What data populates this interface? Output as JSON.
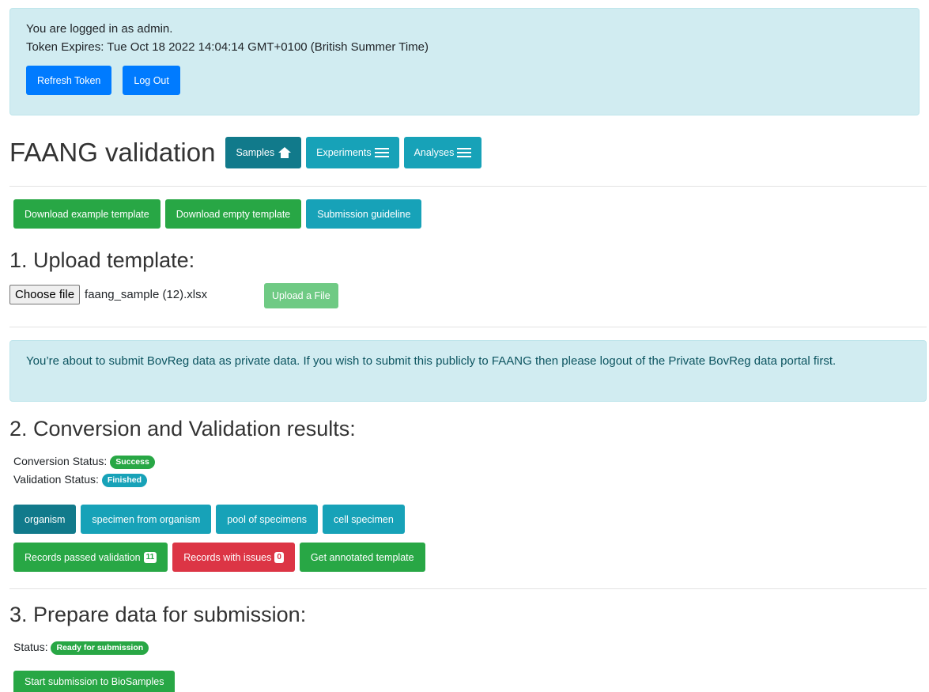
{
  "login": {
    "line1": "You are logged in as admin.",
    "line2": "Token Expires: Tue Oct 18 2022 14:04:14 GMT+0100 (British Summer Time)",
    "refresh_label": "Refresh Token",
    "logout_label": "Log Out"
  },
  "header": {
    "title": "FAANG validation",
    "tabs": [
      {
        "label": "Samples",
        "icon": "home-icon",
        "active": true
      },
      {
        "label": "Experiments",
        "icon": "menu-icon",
        "active": false
      },
      {
        "label": "Analyses",
        "icon": "menu-icon",
        "active": false
      }
    ]
  },
  "templates": {
    "download_example": "Download example template",
    "download_empty": "Download empty template",
    "guideline": "Submission guideline"
  },
  "upload": {
    "heading": "1. Upload template:",
    "choose_label": "Choose file",
    "file_name": "faang_sample (12).xlsx",
    "upload_label": "Upload a File"
  },
  "notice": {
    "text": "You’re about to submit BovReg data as private data. If you wish to submit this publicly to FAANG then please logout of the Private BovReg data portal first."
  },
  "results": {
    "heading": "2. Conversion and Validation results:",
    "conversion_label": "Conversion Status:",
    "conversion_value": "Success",
    "validation_label": "Validation Status:",
    "validation_value": "Finished",
    "types": [
      {
        "label": "organism",
        "active": true
      },
      {
        "label": "specimen from organism",
        "active": false
      },
      {
        "label": "pool of specimens",
        "active": false
      },
      {
        "label": "cell specimen",
        "active": false
      }
    ],
    "passed_label": "Records passed validation",
    "passed_count": "11",
    "issues_label": "Records with issues",
    "issues_count": "0",
    "annotated_label": "Get annotated template"
  },
  "submission": {
    "heading": "3. Prepare data for submission:",
    "status_label": "Status:",
    "status_value": "Ready for submission",
    "start_label": "Start submission to BioSamples"
  },
  "colors": {
    "primary": "#007bff",
    "success": "#28a745",
    "info": "#17a2b8",
    "info_active": "#117a8b",
    "danger": "#dc3545",
    "alert_bg": "#d1ecf1"
  }
}
